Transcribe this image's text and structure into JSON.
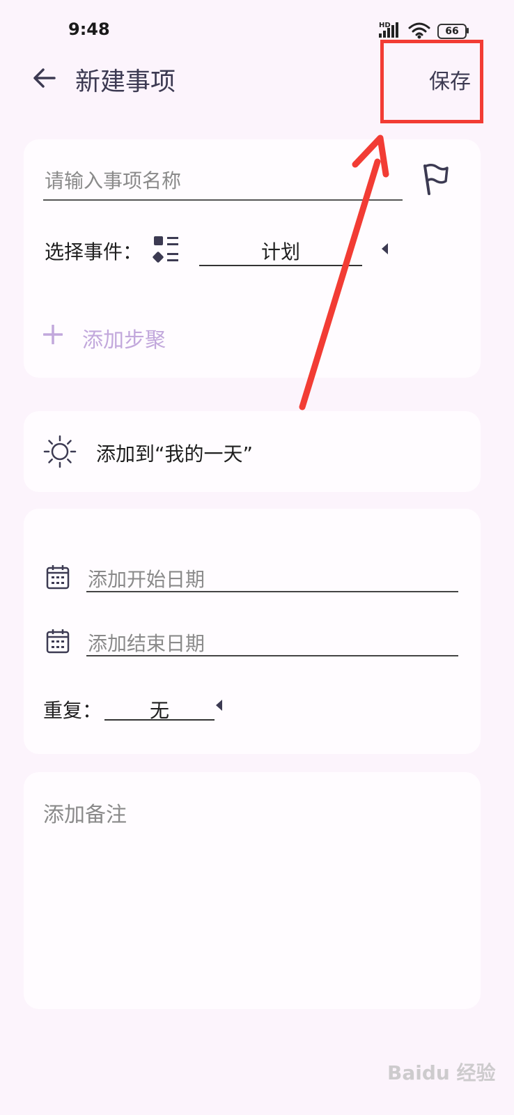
{
  "status_bar": {
    "time": "9:48",
    "network": "HD",
    "battery": "66"
  },
  "header": {
    "title": "新建事项",
    "save_label": "保存"
  },
  "task": {
    "name_placeholder": "请输入事项名称",
    "event_label": "选择事件：",
    "event_value": "计划",
    "add_step_label": "添加步聚"
  },
  "myday": {
    "label": "添加到“我的一天”"
  },
  "schedule": {
    "start_placeholder": "添加开始日期",
    "end_placeholder": "添加结束日期",
    "repeat_label": "重复：",
    "repeat_value": "无"
  },
  "notes": {
    "placeholder": "添加备注"
  },
  "watermark": {
    "text": "Baidu 经验"
  },
  "colors": {
    "accent": "#c2a8dc",
    "highlight": "#f23c34",
    "background": "#fcf4fc",
    "card": "#fffcff",
    "icon": "#3c3a52"
  }
}
